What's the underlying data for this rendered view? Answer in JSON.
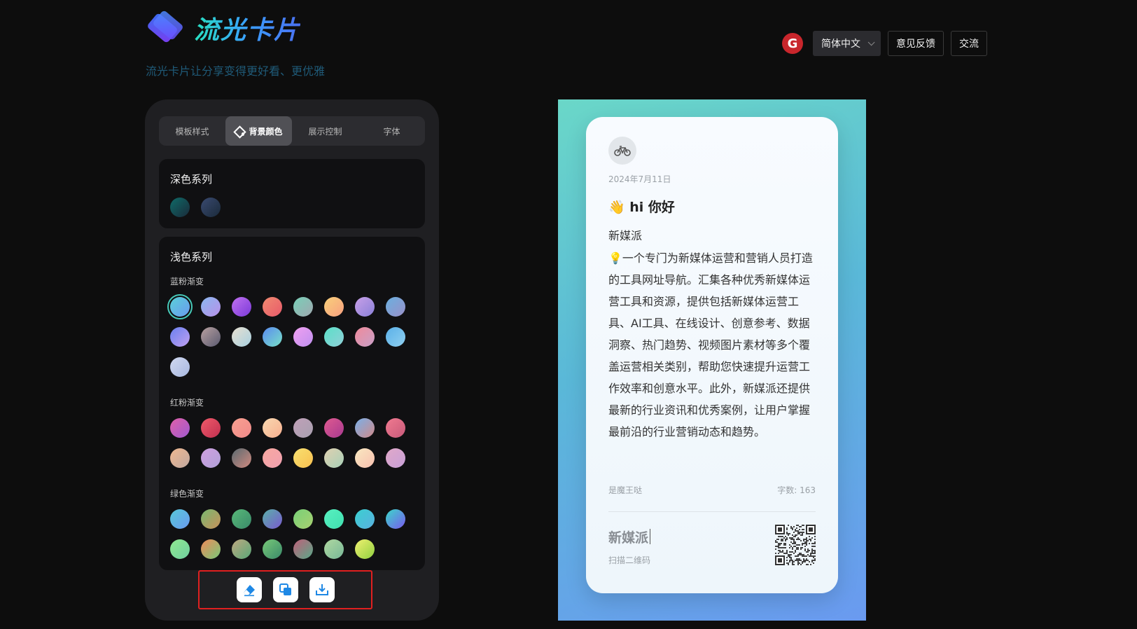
{
  "header": {
    "logo_text": "流光卡片",
    "tagline": "流光卡片让分享变得更好看、更优雅",
    "github_icon": "gitee-icon",
    "language": "简体中文",
    "feedback": "意见反馈",
    "exchange": "交流"
  },
  "tabs": [
    {
      "label": "模板样式",
      "active": false
    },
    {
      "label": "背景颜色",
      "active": true,
      "icon": "paint-bucket-icon"
    },
    {
      "label": "展示控制",
      "active": false
    },
    {
      "label": "字体",
      "active": false
    }
  ],
  "dark_series": {
    "title": "深色系列",
    "colors": [
      "#0f6b68",
      "#3a4a70"
    ]
  },
  "light_series": {
    "title": "浅色系列",
    "groups": [
      {
        "name": "蓝粉渐变",
        "colors": [
          "linear-gradient(135deg,#5ad0d8,#6a9af0)",
          "linear-gradient(135deg,#8ab8f0,#b890e8)",
          "linear-gradient(135deg,#c070f0,#7a3ad8)",
          "linear-gradient(135deg,#f08a70,#e85a6a)",
          "linear-gradient(135deg,#78d0b8,#a0a8b0)",
          "linear-gradient(135deg,#f8d07a,#f8a080)",
          "linear-gradient(135deg,#c8a0e8,#8a80d8)",
          "linear-gradient(135deg,#6ab0e0,#9a90c8)",
          "linear-gradient(135deg,#6a80f0,#c0a0f0)",
          "linear-gradient(135deg,#b8a0a0,#5a5a70)",
          "linear-gradient(135deg,#e8e0d0,#a8d0e0)",
          "linear-gradient(135deg,#5a8af0,#78e0c8)",
          "linear-gradient(135deg,#f0a0f0,#c090f0)",
          "linear-gradient(135deg,#5ae0c8,#90d0d8)",
          "linear-gradient(135deg,#f08a9a,#c8a0c8)",
          "linear-gradient(135deg,#5ab0e8,#90d0f0)",
          "linear-gradient(135deg,#d0d8f0,#a8b8e0)"
        ]
      },
      {
        "name": "红粉渐变",
        "colors": [
          "linear-gradient(135deg,#e060a8,#a05ad0)",
          "linear-gradient(135deg,#f05a6a,#c03050)",
          "linear-gradient(135deg,#f8a090,#f08a8a)",
          "linear-gradient(135deg,#f8d8b0,#f8b090)",
          "linear-gradient(135deg,#c0a0b8,#a8a0b0)",
          "linear-gradient(135deg,#e05a90,#a83a90)",
          "linear-gradient(135deg,#7ab0e8,#d08a8a)",
          "linear-gradient(135deg,#f07a90,#c85a7a)",
          "linear-gradient(135deg,#f0b890,#c0a8a0)",
          "linear-gradient(135deg,#d0a0e0,#b0a0d8)",
          "linear-gradient(135deg,#5a6a70,#d08a80)",
          "linear-gradient(135deg,#f8a8a0,#f0a0b0)",
          "linear-gradient(135deg,#f8e070,#f8c050)",
          "linear-gradient(135deg,#e0d0b0,#a8d0b8)",
          "linear-gradient(135deg,#f8e8c0,#f8c0b0)",
          "linear-gradient(135deg,#e0a8c8,#c8a0d8)"
        ]
      },
      {
        "name": "绿色渐变",
        "colors": [
          "linear-gradient(135deg,#58c8d8,#6a9af0)",
          "linear-gradient(135deg,#78b870,#c8905a)",
          "linear-gradient(135deg,#58b878,#3a8a6a)",
          "linear-gradient(135deg,#5ab0a8,#7a5ad0)",
          "linear-gradient(135deg,#78d078,#a8d070)",
          "linear-gradient(135deg,#58f0c0,#40e0b0)",
          "linear-gradient(135deg,#3ad0d0,#5ab0e0)",
          "linear-gradient(135deg,#3ad8c8,#7a5af0)",
          "linear-gradient(135deg,#90e890,#70d0a0)",
          "linear-gradient(135deg,#f08a5a,#78c878)",
          "linear-gradient(135deg,#c0a880,#58a878)",
          "linear-gradient(135deg,#78c878,#3a8a6a)",
          "linear-gradient(135deg,#c0607a,#58a888)",
          "linear-gradient(135deg,#b0d8a0,#78b898)",
          "linear-gradient(135deg,#f0f070,#90d040)"
        ]
      }
    ]
  },
  "actions": [
    {
      "name": "eraser-icon",
      "label": "清除"
    },
    {
      "name": "copy-icon",
      "label": "复制"
    },
    {
      "name": "download-icon",
      "label": "下载"
    }
  ],
  "card": {
    "avatar_icon": "bicycle-icon",
    "date": "2024年7月11日",
    "title": "👋 hi 你好",
    "subtitle": "新媒派",
    "body": "💡一个专门为新媒体运营和营销人员打造的工具网址导航。汇集各种优秀新媒体运营工具和资源，提供包括新媒体运营工具、AI工具、在线设计、创意参考、数据洞察、热门趋势、视频图片素材等多个覆盖运营相关类别，帮助您快速提升运营工作效率和创意水平。此外，新媒派还提供最新的行业资讯和优秀案例，让用户掌握最前沿的行业营销动态和趋势。",
    "author": "是魔王哒",
    "word_count": "字数: 163",
    "brand": "新媒派",
    "scan_text": "扫描二维码"
  },
  "colors": {
    "accent_selected": "#46c9b8",
    "highlight_border": "#e02020",
    "action_icon": "#1e88e5"
  }
}
